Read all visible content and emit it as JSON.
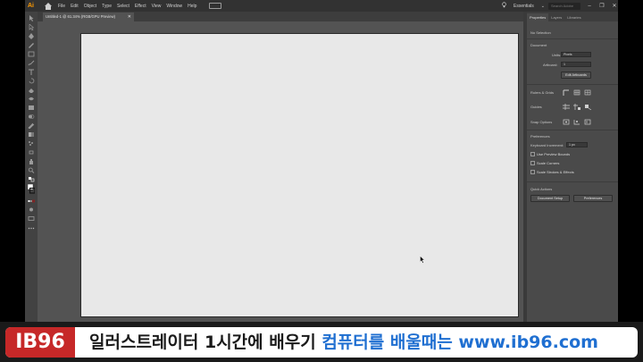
{
  "menubar": {
    "logo": "Ai",
    "items": [
      "File",
      "Edit",
      "Object",
      "Type",
      "Select",
      "Effect",
      "View",
      "Window",
      "Help"
    ],
    "workspace": "Essentials",
    "search_placeholder": "Search Adobe Stock",
    "win_controls": [
      "–",
      "❐",
      "✕"
    ]
  },
  "document_tab": {
    "title": "Untitled-1 @ 61.34% (RGB/GPU Preview)",
    "close": "✕"
  },
  "panel": {
    "tabs": [
      "Properties",
      "Layers",
      "Libraries"
    ],
    "no_selection": "No Selection",
    "document_section": "Document",
    "units_label": "Units:",
    "units_value": "Pixels",
    "artboard_label": "Artboard:",
    "artboard_value": "1",
    "edit_artboards": "Edit Artboards",
    "rulers_grids": "Rulers & Grids",
    "guides": "Guides",
    "snap_options": "Snap Options",
    "preferences_section": "Preferences",
    "keyboard_increment_label": "Keyboard Increment:",
    "keyboard_increment_value": "1 px",
    "use_preview_bounds": "Use Preview Bounds",
    "scale_corners": "Scale Corners",
    "scale_strokes": "Scale Strokes & Effects",
    "quick_actions": "Quick Actions",
    "document_setup": "Document Setup",
    "preferences_button": "Preferences"
  },
  "banner": {
    "brand": "IB96",
    "text_main": "일러스트레이터 1시간에 배우기 ",
    "text_highlight": "컴퓨터를 배울때는 ",
    "text_url": "www.ib96.com"
  },
  "colors": {
    "accent_orange": "#ff9a00",
    "brand_red": "#c62828",
    "highlight_blue": "#1f6fd1"
  }
}
